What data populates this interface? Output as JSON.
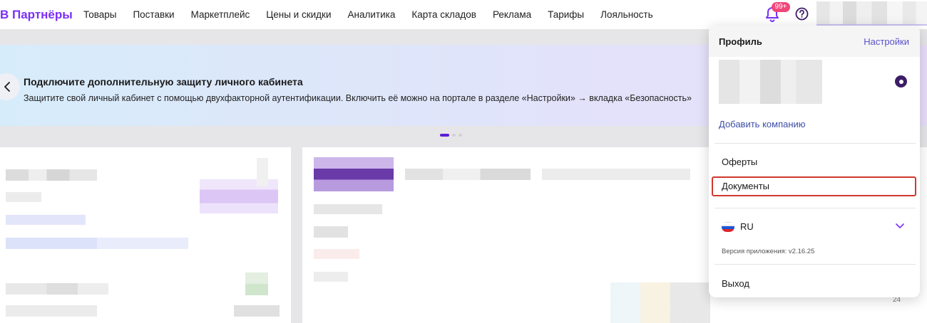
{
  "header": {
    "logo": "В Партнёры",
    "nav": [
      "Товары",
      "Поставки",
      "Маркетплейс",
      "Цены и скидки",
      "Аналитика",
      "Карта складов",
      "Реклама",
      "Тарифы",
      "Лояльность"
    ],
    "notifications_badge": "99+"
  },
  "banner": {
    "title": "Подключите дополнительную защиту личного кабинета",
    "text": "Защитите свой личный кабинет с помощью двухфакторной аутентификации. Включить её можно на портале в разделе «Настройки» → вкладка «Безопасность»",
    "slides_total": 3,
    "slide_active": 1
  },
  "profile_menu": {
    "title": "Профиль",
    "settings_link": "Настройки",
    "add_company": "Добавить компанию",
    "items": [
      "Оферты",
      "Документы"
    ],
    "language": "RU",
    "version": "Версия приложения: v2.16.25",
    "logout": "Выход"
  },
  "chart_axis_label": "24",
  "colors": {
    "brand": "#7b2ff7",
    "badge": "#f0467a",
    "highlight_border": "#d0382f",
    "link": "#5a52c8"
  }
}
